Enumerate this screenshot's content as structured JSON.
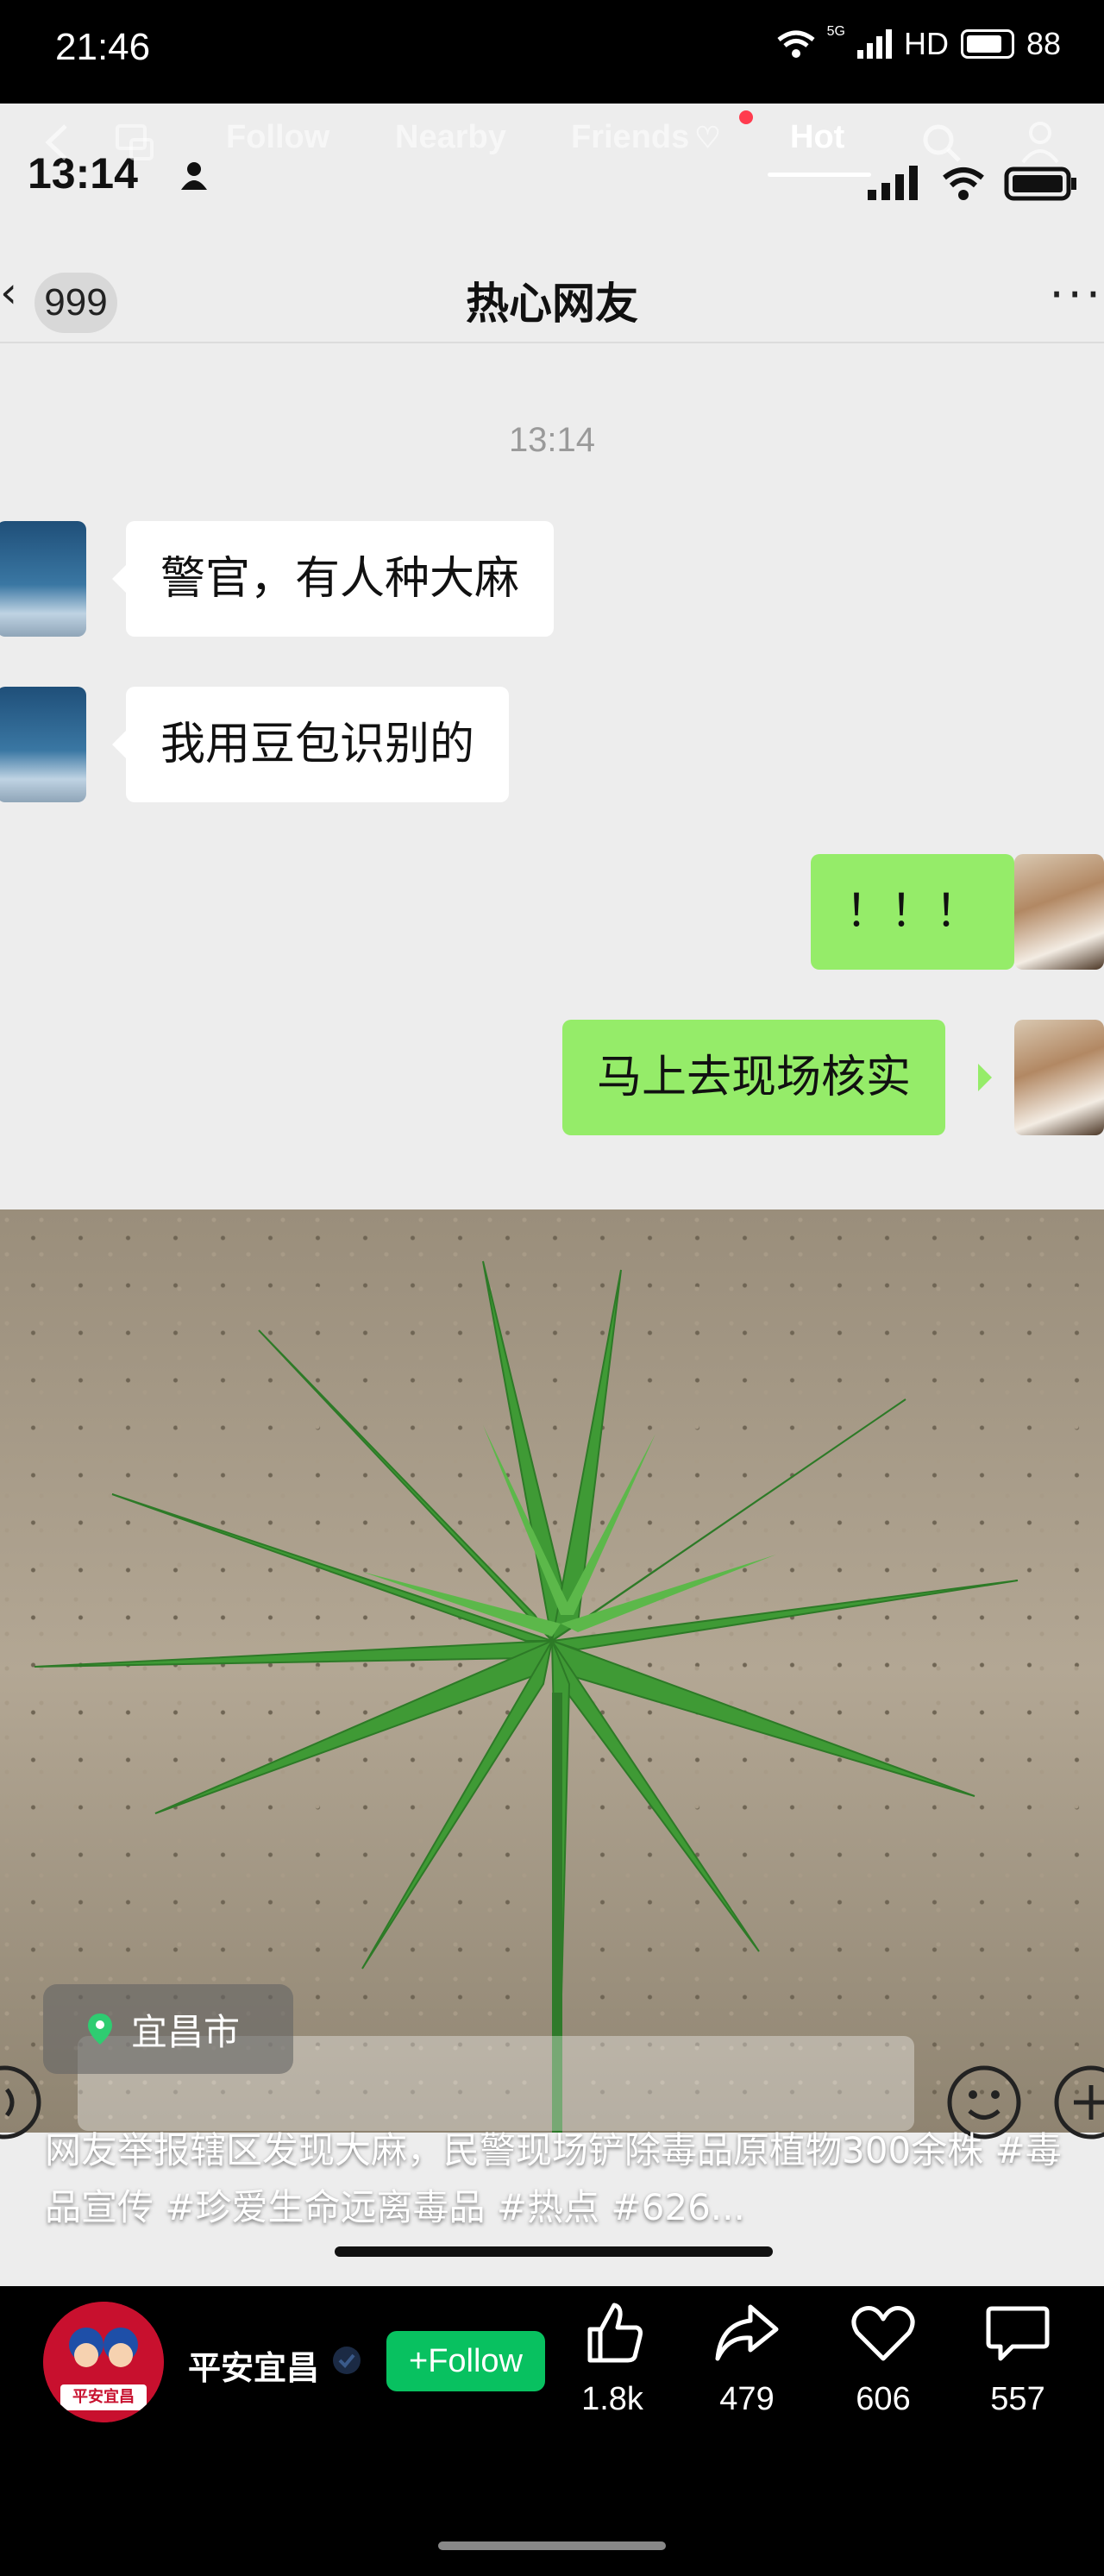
{
  "status_bar": {
    "time": "21:46",
    "network": "5G",
    "hd": "HD",
    "battery": "88"
  },
  "inner_status": {
    "time": "13:14"
  },
  "top_nav": {
    "tabs": [
      "Follow",
      "Nearby",
      "Friends",
      "Hot"
    ],
    "active_tab": "Hot"
  },
  "chat": {
    "unread": "999",
    "title": "热心网友",
    "more": "···",
    "timestamp": "13:14",
    "messages": [
      {
        "side": "in",
        "text": "警官，有人种大麻"
      },
      {
        "side": "in",
        "text": "我用豆包识别的"
      },
      {
        "side": "out",
        "text": "！！！"
      },
      {
        "side": "out",
        "text": "马上去现场核实"
      }
    ]
  },
  "location": {
    "label": "宜昌市"
  },
  "caption": "网友举报辖区发现大麻，民警现场铲除毒品原植物300余株 #毒品宣传 #珍爱生命远离毒品 #热点 #626...",
  "author": {
    "name": "平安宜昌",
    "avatar_text": "平安宜昌",
    "follow_label": "+Follow"
  },
  "actions": {
    "like": {
      "count": "1.8k",
      "icon": "thumbs-up-icon"
    },
    "share": {
      "count": "479",
      "icon": "share-icon"
    },
    "favorite": {
      "count": "606",
      "icon": "heart-icon"
    },
    "comment": {
      "count": "557",
      "icon": "comment-icon"
    }
  },
  "colors": {
    "accent_green": "#08c160",
    "bubble_out": "#95ec69",
    "notify_red": "#ff3b4e"
  }
}
